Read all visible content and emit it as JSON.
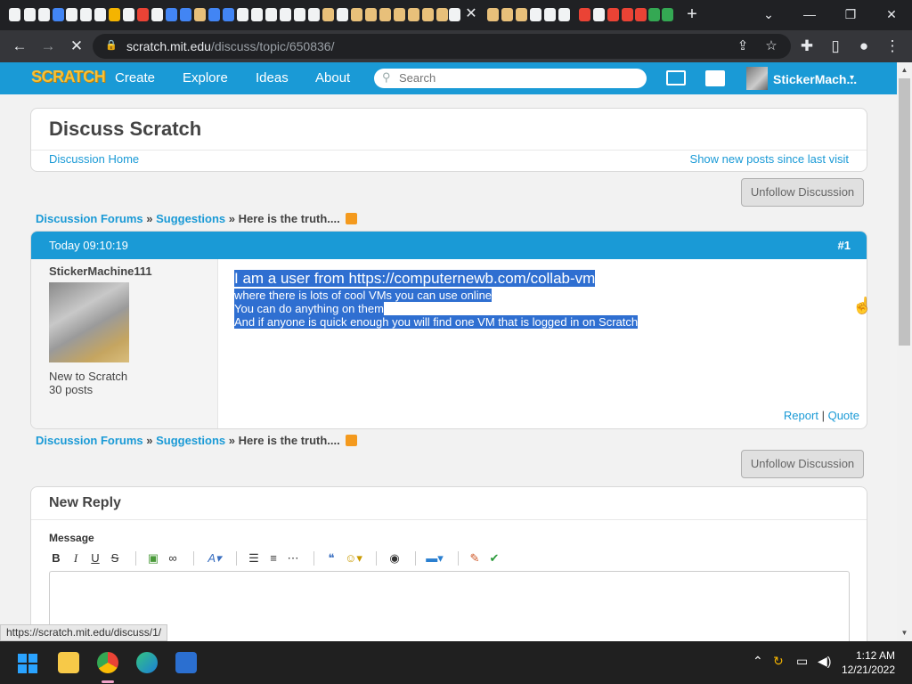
{
  "browser": {
    "url_domain": "scratch.mit.edu",
    "url_path": "/discuss/topic/650836/",
    "status_url": "https://scratch.mit.edu/discuss/1/"
  },
  "nav": {
    "logo": "SCRATCH",
    "links": [
      "Create",
      "Explore",
      "Ideas",
      "About"
    ],
    "search_placeholder": "Search",
    "username": "StickerMach..."
  },
  "page": {
    "title": "Discuss Scratch",
    "home_link": "Discussion Home",
    "new_posts_link": "Show new posts since last visit",
    "unfollow_label": "Unfollow Discussion",
    "breadcrumb": {
      "forums": "Discussion Forums",
      "sep": "»",
      "category": "Suggestions",
      "topic": "Here is the truth...."
    }
  },
  "post": {
    "time": "Today 09:10:19",
    "number": "#1",
    "author": "StickerMachine111",
    "rank": "New to Scratch",
    "post_count": "30 posts",
    "lines": [
      "I am a user from https://computernewb.com/collab-vm",
      "where there is lots of cool VMs you can use online",
      "You can do anything on them",
      "And if anyone is quick enough you will find one VM that is logged in on Scratch"
    ],
    "report": "Report",
    "divider": "|",
    "quote": "Quote"
  },
  "reply": {
    "title": "New Reply",
    "message_label": "Message",
    "tools": [
      "B",
      "I",
      "U",
      "S"
    ]
  },
  "taskbar": {
    "time": "1:12 AM",
    "date": "12/21/2022"
  }
}
